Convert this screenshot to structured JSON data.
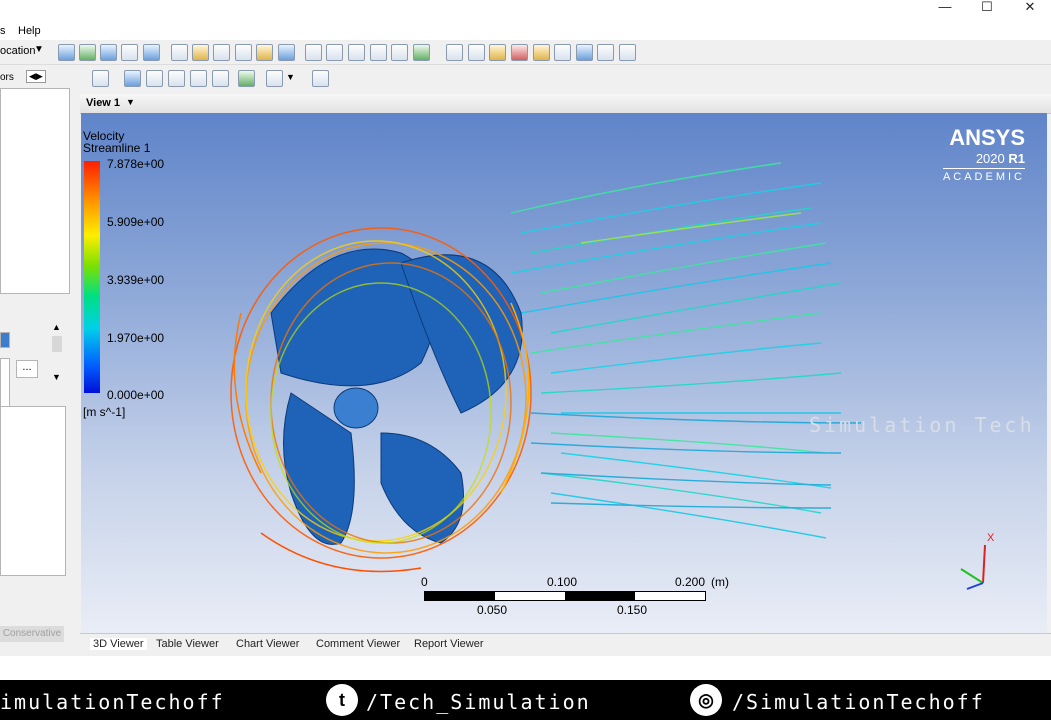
{
  "window": {
    "minimize": "—",
    "maximize": "☐",
    "close": "✕"
  },
  "menu": {
    "item_cut": "s",
    "help": "Help"
  },
  "toolbar": {
    "location_label": "ocation"
  },
  "left_panel": {
    "tab_label": "ors",
    "ellipsis_button": "...",
    "conservative_label": "Conservative"
  },
  "view": {
    "selector_label": "View 1",
    "legend": {
      "variable": "Velocity",
      "object": "Streamline 1",
      "ticks": [
        "7.878e+00",
        "5.909e+00",
        "3.939e+00",
        "1.970e+00",
        "0.000e+00"
      ],
      "unit": "[m s^-1]"
    },
    "branding": {
      "product": "ANSYS",
      "version_year": "2020",
      "version_release": "R1",
      "edition": "ACADEMIC"
    },
    "watermark": "Simulation Tech",
    "scale_bar": {
      "top_labels": [
        "0",
        "0.100",
        "0.200"
      ],
      "unit": "(m)",
      "bottom_labels": [
        "0.050",
        "0.150"
      ]
    },
    "axis_label": "X"
  },
  "bottom_tabs": [
    "3D Viewer",
    "Table Viewer",
    "Chart Viewer",
    "Comment Viewer",
    "Report Viewer"
  ],
  "social": {
    "left_text": "imulationTechoff",
    "twitter_icon": "t",
    "twitter_text": "/Tech_Simulation",
    "instagram_icon": "◎",
    "instagram_text": "/SimulationTechoff"
  }
}
